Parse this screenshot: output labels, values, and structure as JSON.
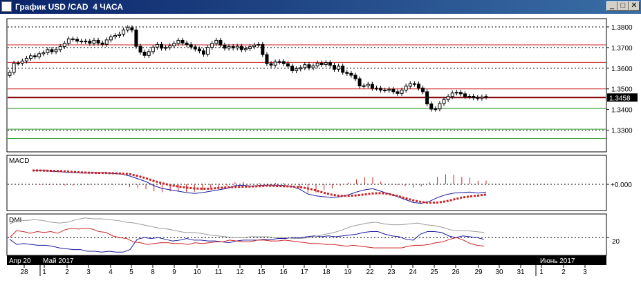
{
  "window": {
    "title": "График USD /CAD  4 ЧАСА",
    "minimize_label": "_",
    "maximize_label": "□",
    "close_label": "✕"
  },
  "colors": {
    "bullish_candle": "#ffffff",
    "bearish_candle": "#000000",
    "resistance_line": "#cc2222",
    "support_line": "#229922",
    "current_price_line": "#800000",
    "macd_line": "#1a1aa0",
    "signal_line": "#cc2222",
    "di_plus": "#1a1aa0",
    "di_minus": "#cc2222",
    "adx": "#999999"
  },
  "chart_data": [
    {
      "type": "candlestick",
      "panel": "price",
      "y_ticks": [
        "1.3800",
        "1.3700",
        "1.3600",
        "1.3500",
        "1.3400",
        "1.3300"
      ],
      "ylim": [
        1.3195,
        1.384
      ],
      "current_price": "1.3458",
      "resistance_levels": [
        1.3713,
        1.3628,
        1.35
      ],
      "support_levels": [
        1.3405,
        1.3305,
        1.326
      ],
      "key_level": 1.3458,
      "dotted_levels": [
        1.38,
        1.37,
        1.36,
        1.33
      ],
      "close": [
        1.358,
        1.3624,
        1.3624,
        1.3635,
        1.3648,
        1.366,
        1.3655,
        1.367,
        1.3675,
        1.369,
        1.368,
        1.369,
        1.3705,
        1.372,
        1.3742,
        1.374,
        1.3731,
        1.3728,
        1.3731,
        1.3721,
        1.3735,
        1.3722,
        1.3716,
        1.3737,
        1.3752,
        1.3758,
        1.3765,
        1.3785,
        1.3796,
        1.3785,
        1.3706,
        1.3678,
        1.3662,
        1.368,
        1.3702,
        1.3715,
        1.3697,
        1.37,
        1.3708,
        1.372,
        1.3735,
        1.3722,
        1.3714,
        1.3703,
        1.3693,
        1.3684,
        1.3668,
        1.3701,
        1.372,
        1.3735,
        1.3712,
        1.3697,
        1.3705,
        1.3698,
        1.3706,
        1.369,
        1.3695,
        1.3704,
        1.3712,
        1.3715,
        1.3666,
        1.3622,
        1.3615,
        1.363,
        1.3632,
        1.3622,
        1.361,
        1.3588,
        1.3597,
        1.3603,
        1.3617,
        1.3602,
        1.3611,
        1.3625,
        1.3618,
        1.3627,
        1.3614,
        1.3595,
        1.361,
        1.358,
        1.3575,
        1.3566,
        1.3549,
        1.3514,
        1.3515,
        1.3522,
        1.3503,
        1.3503,
        1.3494,
        1.3493,
        1.3498,
        1.3486,
        1.3478,
        1.3494,
        1.3513,
        1.3525,
        1.3523,
        1.3504,
        1.3486,
        1.3427,
        1.3402,
        1.3403,
        1.3429,
        1.3448,
        1.3463,
        1.348,
        1.3483,
        1.3476,
        1.3463,
        1.3464,
        1.3457,
        1.3455,
        1.346,
        1.3463
      ],
      "x_tick_labels": [
        "28",
        "1",
        "2",
        "3",
        "4",
        "5",
        "8",
        "9",
        "10",
        "11",
        "12",
        "15",
        "16",
        "17",
        "18",
        "19",
        "22",
        "23",
        "24",
        "25",
        "26",
        "29",
        "30",
        "31",
        "1",
        "2",
        "3"
      ],
      "period_labels": [
        "Апр 20",
        "Май 2017",
        "Июнь 2017"
      ]
    },
    {
      "type": "line",
      "panel": "macd",
      "label": "MACD",
      "y_tick": "+0.000",
      "series": [
        {
          "name": "macd",
          "values": [
            0.00495,
            0.0049,
            0.0048,
            0.0046,
            0.0044,
            0.0042,
            0.0041,
            0.0041,
            0.0042,
            0.0041,
            0.0039,
            0.0037,
            0.003,
            0.002,
            0.001,
            -0.0005,
            -0.0015,
            -0.002,
            -0.0025,
            -0.003,
            -0.0033,
            -0.003,
            -0.0025,
            -0.002,
            -0.0015,
            -0.0005,
            -0.0003,
            -0.0007,
            -0.0004,
            -0.0003,
            -0.0003,
            -0.0004,
            -0.0008,
            -0.0018,
            -0.0035,
            -0.0042,
            -0.0045,
            -0.0048,
            -0.0045,
            -0.0038,
            -0.0028,
            -0.002,
            -0.0016,
            -0.0025,
            -0.0035,
            -0.0044,
            -0.0055,
            -0.0066,
            -0.0069,
            -0.0062,
            -0.0048,
            -0.0038,
            -0.0032,
            -0.003,
            -0.0028,
            -0.0032,
            -0.0028
          ]
        },
        {
          "name": "signal",
          "values": [
            0.005,
            0.005,
            0.0049,
            0.0048,
            0.0047,
            0.0045,
            0.0043,
            0.0042,
            0.0041,
            0.0041,
            0.004,
            0.0039,
            0.0037,
            0.003,
            0.0022,
            0.0012,
            0.0004,
            -0.0003,
            -0.0008,
            -0.0012,
            -0.0015,
            -0.0016,
            -0.0016,
            -0.0013,
            -0.0011,
            -0.001,
            -0.0009,
            -0.0008,
            -0.0007,
            -0.0005,
            -0.0006,
            -0.0007,
            -0.0008,
            -0.001,
            -0.0015,
            -0.0022,
            -0.0031,
            -0.0038,
            -0.0042,
            -0.0042,
            -0.004,
            -0.0037,
            -0.0033,
            -0.0032,
            -0.0035,
            -0.0042,
            -0.005,
            -0.0058,
            -0.0064,
            -0.0067,
            -0.0066,
            -0.0062,
            -0.0055,
            -0.0048,
            -0.0044,
            -0.0041,
            -0.0037
          ]
        }
      ]
    },
    {
      "type": "line",
      "panel": "dmi",
      "label": "DMI",
      "y_tick": "20",
      "series": [
        {
          "name": "di_plus",
          "values": [
            18,
            12,
            13,
            12,
            11,
            11,
            10,
            8,
            7,
            6,
            6,
            4,
            4,
            3,
            4,
            3,
            3,
            6,
            18,
            20,
            19,
            20,
            18,
            16,
            17,
            19,
            17,
            17,
            16,
            16,
            15,
            14,
            16,
            17,
            17,
            17,
            18,
            18,
            19,
            19,
            20,
            20,
            21,
            22,
            21,
            22,
            21,
            22,
            23,
            24,
            26,
            27,
            27,
            24,
            22,
            21,
            18,
            17,
            24,
            27,
            27,
            26,
            22,
            20,
            22,
            21,
            20,
            18
          ]
        },
        {
          "name": "di_minus",
          "values": [
            20,
            28,
            27,
            25,
            27,
            26,
            27,
            25,
            29,
            31,
            30,
            31,
            30,
            27,
            26,
            22,
            20,
            19,
            15,
            14,
            12,
            13,
            14,
            14,
            13,
            13,
            12,
            14,
            13,
            14,
            15,
            15,
            17,
            16,
            15,
            15,
            17,
            17,
            16,
            16,
            17,
            16,
            15,
            14,
            13,
            13,
            12,
            12,
            11,
            10,
            11,
            10,
            9,
            8,
            8,
            8,
            8,
            8,
            10,
            11,
            11,
            12,
            14,
            15,
            18,
            20,
            17,
            13,
            11,
            10
          ]
        },
        {
          "name": "adx",
          "values": [
            36,
            40,
            40,
            41,
            40,
            38,
            37,
            38,
            41,
            43,
            42,
            42,
            41,
            40,
            38,
            37,
            35,
            33,
            31,
            30,
            28,
            26,
            26,
            25,
            23,
            22,
            21,
            20,
            20,
            21,
            21,
            21,
            20,
            20,
            19,
            19,
            20,
            22,
            24,
            26,
            29,
            33,
            35,
            37,
            38,
            36,
            35,
            35,
            36,
            37,
            35,
            34,
            32,
            29,
            28,
            28,
            27,
            26
          ]
        }
      ],
      "ylim": [
        0,
        46
      ]
    }
  ]
}
